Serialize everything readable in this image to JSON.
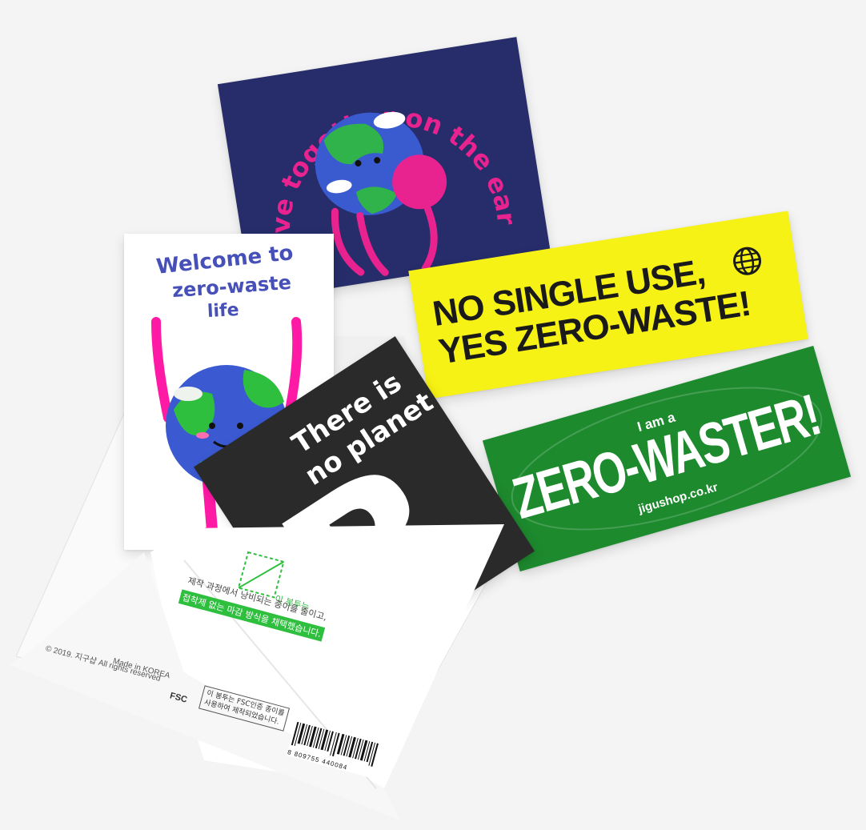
{
  "stickers": {
    "navy": {
      "text": "Live together on the earth",
      "bg": "#262d6a",
      "text_color": "#e8228f"
    },
    "welcome": {
      "line1": "Welcome to",
      "line2": "zero-waste",
      "line3": "life"
    },
    "yellow": {
      "line1": "NO SINGLE USE,",
      "line2": "YES ZERO-WASTE!",
      "icon": "globe-icon",
      "bg": "#f7f215"
    },
    "black": {
      "line1": "There is",
      "line2": "no planet",
      "letter": "B"
    },
    "green": {
      "small": "I am a",
      "big": "ZERO-WASTER!",
      "site": "jigushop.co.kr",
      "bg": "#1d8a2e"
    }
  },
  "envelope": {
    "copyright": "© 2019. 지구샵 All rights reserved",
    "made_in": "Made in KOREA",
    "fsc": "FSC",
    "fsc_note_1": "이 봉투는 FSC인증 종이를",
    "fsc_note_2": "사용하여 제작되었습니다.",
    "eco_note_1": "이 봉투는",
    "eco_note_2": "제작 과정에서 낭비되는 종이를 줄이고,",
    "eco_note_3": "접착제 없는 마감 방식을 채택했습니다.",
    "barcode": "8 809755 440084",
    "accent": "#2fbf3f"
  }
}
